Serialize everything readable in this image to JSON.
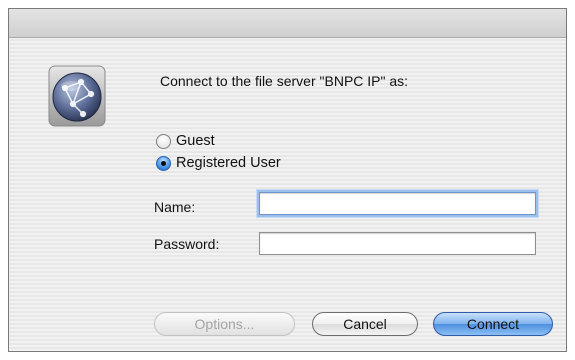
{
  "dialog": {
    "prompt": "Connect to the file server \"BNPC IP\" as:",
    "icon": "server-globe-icon"
  },
  "login_type": {
    "guest_label": "Guest",
    "registered_label": "Registered User",
    "selected": "Registered User"
  },
  "fields": {
    "name_label": "Name:",
    "name_value": "",
    "password_label": "Password:",
    "password_value": ""
  },
  "buttons": {
    "options_label": "Options...",
    "cancel_label": "Cancel",
    "connect_label": "Connect"
  },
  "colors": {
    "accent_blue": "#4f8fe0",
    "disabled_text": "#a3a3a3"
  }
}
